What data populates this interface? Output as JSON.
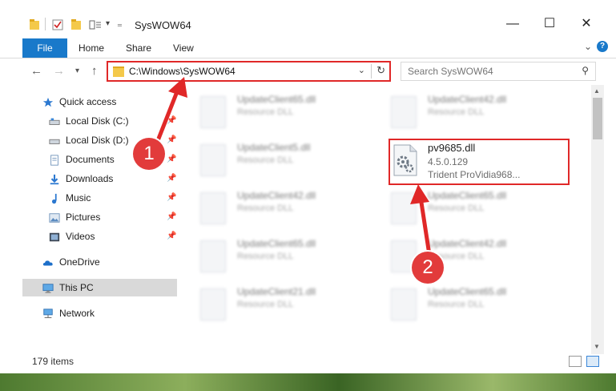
{
  "window": {
    "title": "SysWOW64"
  },
  "ribbon": {
    "tabs": [
      "File",
      "Home",
      "Share",
      "View"
    ]
  },
  "address": {
    "path": "C:\\Windows\\SysWOW64"
  },
  "search": {
    "placeholder": "Search SysWOW64"
  },
  "sidebar": {
    "items": [
      {
        "label": "Quick access",
        "icon": "star-icon"
      },
      {
        "label": "Local Disk (C:)",
        "icon": "drive-icon"
      },
      {
        "label": "Local Disk (D:)",
        "icon": "drive-icon"
      },
      {
        "label": "Documents",
        "icon": "documents-icon"
      },
      {
        "label": "Downloads",
        "icon": "downloads-icon"
      },
      {
        "label": "Music",
        "icon": "music-icon"
      },
      {
        "label": "Pictures",
        "icon": "pictures-icon"
      },
      {
        "label": "Videos",
        "icon": "videos-icon"
      },
      {
        "label": "OneDrive",
        "icon": "cloud-icon"
      },
      {
        "label": "This PC",
        "icon": "computer-icon"
      },
      {
        "label": "Network",
        "icon": "network-icon"
      }
    ]
  },
  "files": [
    {
      "name": "UpdateClient65.dll",
      "sub": "Resource DLL"
    },
    {
      "name": "UpdateClient42.dll",
      "sub": "Resource DLL"
    },
    {
      "name": "UpdateClient5.dll",
      "sub": "Resource DLL"
    },
    {
      "name": "pv9685.dll",
      "version": "4.5.0.129",
      "desc": "Trident ProVidia968..."
    },
    {
      "name": "UpdateClient42.dll",
      "sub": "Resource DLL"
    },
    {
      "name": "UpdateClient65.dll",
      "sub": "Resource DLL"
    },
    {
      "name": "UpdateClient65.dll",
      "sub": "Resource DLL"
    },
    {
      "name": "UpdateClient42.dll",
      "sub": "Resource DLL"
    },
    {
      "name": "UpdateClient21.dll",
      "sub": "Resource DLL"
    },
    {
      "name": "UpdateClient65.dll",
      "sub": "Resource DLL"
    }
  ],
  "status": {
    "count": "179 items"
  },
  "callouts": {
    "one": "1",
    "two": "2"
  },
  "colors": {
    "accent": "#1979ca",
    "highlight": "#e02828",
    "callout": "#e23b3b"
  }
}
